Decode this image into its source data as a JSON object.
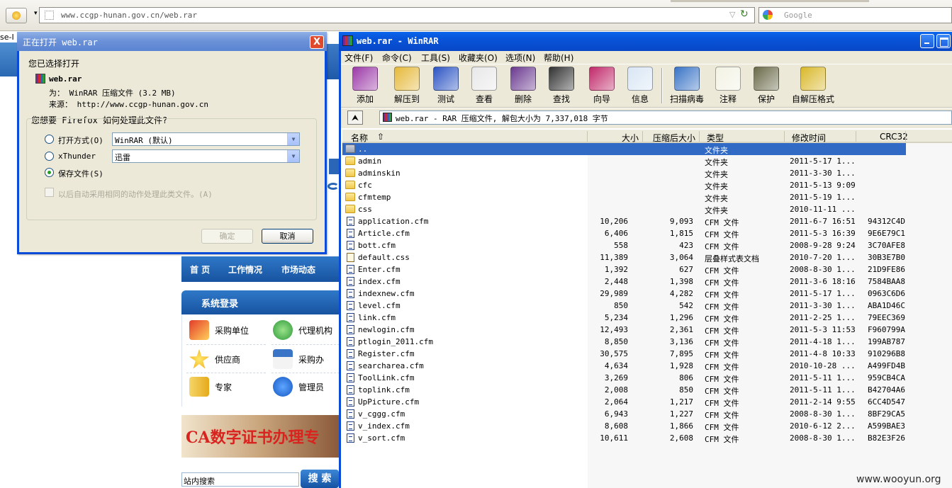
{
  "browser": {
    "url": "www.ccgp-hunan.gov.cn/web.rar",
    "search_placeholder": "Google",
    "back_dropdown": "▾",
    "reload": "↻",
    "go": "▽"
  },
  "bg_page": {
    "frag_text": "se-I",
    "nav": [
      "首 页",
      "工作情况",
      "市场动态"
    ],
    "login_title": "系统登录",
    "login_items": [
      "采购单位",
      "代理机构",
      "供应商",
      "采购办",
      "专家",
      "管理员"
    ],
    "ca_banner": "CA数字证书办理专",
    "search_input": "站内搜索",
    "search_button": "搜 索"
  },
  "dialog": {
    "title": "正在打开 web.rar",
    "heading": "您已选择打开",
    "filename": "web.rar",
    "type_line": "为： WinRAR 压缩文件 (3.2 MB)",
    "source_line": "来源： http://www.ccgp-hunan.gov.cn",
    "question": "您想要 Firefox 如何处理此文件?",
    "option_open": "打开方式(O)",
    "option_open_value": "WinRAR (默认)",
    "option_xthunder": "xThunder",
    "option_xthunder_value": "迅雷",
    "option_save": "保存文件(S)",
    "auto_checkbox": "以后自动采用相同的动作处理此类文件。(A)",
    "ok": "确定",
    "cancel": "取消",
    "close": "X"
  },
  "winrar": {
    "title": "web.rar - WinRAR",
    "menus": [
      "文件(F)",
      "命令(C)",
      "工具(S)",
      "收藏夹(O)",
      "选项(N)",
      "帮助(H)"
    ],
    "tools": [
      {
        "label": "添加",
        "icon": "add-books-icon",
        "color": "#9c3aa8"
      },
      {
        "label": "解压到",
        "icon": "extract-folder-icon",
        "color": "#e6b93a"
      },
      {
        "label": "测试",
        "icon": "test-book-icon",
        "color": "#2d55c4"
      },
      {
        "label": "查看",
        "icon": "view-glasses-icon",
        "color": "#e8e8e8"
      },
      {
        "label": "删除",
        "icon": "delete-icon",
        "color": "#6b3a90"
      },
      {
        "label": "查找",
        "icon": "binoculars-icon",
        "color": "#333333"
      },
      {
        "label": "向导",
        "icon": "wizard-icon",
        "color": "#c12a6a"
      },
      {
        "label": "信息",
        "icon": "info-icon",
        "color": "#d9e6f4"
      },
      {
        "label": "扫描病毒",
        "icon": "virus-scan-icon",
        "color": "#3a74c6"
      },
      {
        "label": "注释",
        "icon": "comment-icon",
        "color": "#f2f2e4"
      },
      {
        "label": "保护",
        "icon": "shield-icon",
        "color": "#6a6a4a"
      },
      {
        "label": "自解压格式",
        "icon": "sfx-icon",
        "color": "#d9b82a"
      }
    ],
    "path": "web.rar - RAR 压缩文件, 解包大小为 7,337,018 字节",
    "up_button": "⮝",
    "columns": {
      "name": "名称",
      "size": "大小",
      "packed": "压缩后大小",
      "type": "类型",
      "modified": "修改时间",
      "crc": "CRC32"
    },
    "rows": [
      {
        "name": "..",
        "size": "",
        "packed": "",
        "type": "文件夹",
        "modified": "",
        "crc": "",
        "kind": "up",
        "selected": true
      },
      {
        "name": "admin",
        "size": "",
        "packed": "",
        "type": "文件夹",
        "modified": "2011-5-17 1...",
        "crc": "",
        "kind": "folder"
      },
      {
        "name": "adminskin",
        "size": "",
        "packed": "",
        "type": "文件夹",
        "modified": "2011-3-30 1...",
        "crc": "",
        "kind": "folder"
      },
      {
        "name": "cfc",
        "size": "",
        "packed": "",
        "type": "文件夹",
        "modified": "2011-5-13 9:09",
        "crc": "",
        "kind": "folder"
      },
      {
        "name": "cfmtemp",
        "size": "",
        "packed": "",
        "type": "文件夹",
        "modified": "2011-5-19 1...",
        "crc": "",
        "kind": "folder"
      },
      {
        "name": "css",
        "size": "",
        "packed": "",
        "type": "文件夹",
        "modified": "2010-11-11 ...",
        "crc": "",
        "kind": "folder"
      },
      {
        "name": "application.cfm",
        "size": "10,206",
        "packed": "9,093",
        "type": "CFM 文件",
        "modified": "2011-6-7 16:51",
        "crc": "94312C4D",
        "kind": "file"
      },
      {
        "name": "Article.cfm",
        "size": "6,406",
        "packed": "1,815",
        "type": "CFM 文件",
        "modified": "2011-5-3 16:39",
        "crc": "9E6E79C1",
        "kind": "file"
      },
      {
        "name": "bott.cfm",
        "size": "558",
        "packed": "423",
        "type": "CFM 文件",
        "modified": "2008-9-28 9:24",
        "crc": "3C70AFE8",
        "kind": "file"
      },
      {
        "name": "default.css",
        "size": "11,389",
        "packed": "3,064",
        "type": "层叠样式表文档",
        "modified": "2010-7-20 1...",
        "crc": "30B3E7B0",
        "kind": "css"
      },
      {
        "name": "Enter.cfm",
        "size": "1,392",
        "packed": "627",
        "type": "CFM 文件",
        "modified": "2008-8-30 1...",
        "crc": "21D9FE86",
        "kind": "file"
      },
      {
        "name": "index.cfm",
        "size": "2,448",
        "packed": "1,398",
        "type": "CFM 文件",
        "modified": "2011-3-6 18:16",
        "crc": "7584BAA8",
        "kind": "file"
      },
      {
        "name": "indexnew.cfm",
        "size": "29,989",
        "packed": "4,282",
        "type": "CFM 文件",
        "modified": "2011-5-17 1...",
        "crc": "0963C6D6",
        "kind": "file"
      },
      {
        "name": "level.cfm",
        "size": "850",
        "packed": "542",
        "type": "CFM 文件",
        "modified": "2011-3-30 1...",
        "crc": "ABA1D46C",
        "kind": "file"
      },
      {
        "name": "link.cfm",
        "size": "5,234",
        "packed": "1,296",
        "type": "CFM 文件",
        "modified": "2011-2-25 1...",
        "crc": "79EEC369",
        "kind": "file"
      },
      {
        "name": "newlogin.cfm",
        "size": "12,493",
        "packed": "2,361",
        "type": "CFM 文件",
        "modified": "2011-5-3 11:53",
        "crc": "F960799A",
        "kind": "file"
      },
      {
        "name": "ptlogin_2011.cfm",
        "size": "8,850",
        "packed": "3,136",
        "type": "CFM 文件",
        "modified": "2011-4-18 1...",
        "crc": "199AB787",
        "kind": "file"
      },
      {
        "name": "Register.cfm",
        "size": "30,575",
        "packed": "7,895",
        "type": "CFM 文件",
        "modified": "2011-4-8 10:33",
        "crc": "910296B8",
        "kind": "file"
      },
      {
        "name": "searcharea.cfm",
        "size": "4,634",
        "packed": "1,928",
        "type": "CFM 文件",
        "modified": "2010-10-28 ...",
        "crc": "A499FD4B",
        "kind": "file"
      },
      {
        "name": "ToolLink.cfm",
        "size": "3,269",
        "packed": "806",
        "type": "CFM 文件",
        "modified": "2011-5-11 1...",
        "crc": "959CB4CA",
        "kind": "file"
      },
      {
        "name": "toplink.cfm",
        "size": "2,008",
        "packed": "850",
        "type": "CFM 文件",
        "modified": "2011-5-11 1...",
        "crc": "B42704A6",
        "kind": "file"
      },
      {
        "name": "UpPicture.cfm",
        "size": "2,064",
        "packed": "1,217",
        "type": "CFM 文件",
        "modified": "2011-2-14 9:55",
        "crc": "6CC4D547",
        "kind": "file"
      },
      {
        "name": "v_cggg.cfm",
        "size": "6,943",
        "packed": "1,227",
        "type": "CFM 文件",
        "modified": "2008-8-30 1...",
        "crc": "8BF29CA5",
        "kind": "file"
      },
      {
        "name": "v_index.cfm",
        "size": "8,608",
        "packed": "1,866",
        "type": "CFM 文件",
        "modified": "2010-6-12 2...",
        "crc": "A599BAE3",
        "kind": "file"
      },
      {
        "name": "v_sort.cfm",
        "size": "10,611",
        "packed": "2,608",
        "type": "CFM 文件",
        "modified": "2008-8-30 1...",
        "crc": "B82E3F26",
        "kind": "file"
      }
    ]
  },
  "watermark": "www.wooyun.org"
}
